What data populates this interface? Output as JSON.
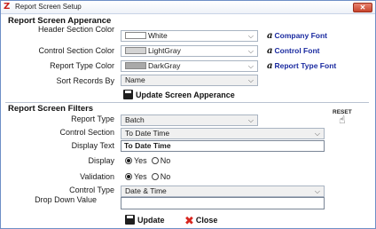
{
  "window": {
    "title": "Report Screen Setup",
    "close_glyph": "✕",
    "app_icon": "Z"
  },
  "appearance": {
    "section_title": "Report Screen Apperance",
    "header_color_label": "Header Section Color",
    "header_color_value": "White",
    "control_color_label": "Control Section Color",
    "control_color_value": "LightGray",
    "report_type_color_label": "Report Type Color",
    "report_type_color_value": "DarkGray",
    "sort_label": "Sort Records By",
    "sort_value": "Name",
    "company_font": "Company Font",
    "control_font": "Control Font",
    "report_type_font": "Report Type Font",
    "update_label": "Update Screen Apperance"
  },
  "filters": {
    "section_title": "Report Screen Filters",
    "report_type_label": "Report Type",
    "report_type_value": "Batch",
    "control_section_label": "Control Section",
    "control_section_value": "To Date Time",
    "display_text_label": "Display Text",
    "display_text_value": "To Date Time",
    "display_label": "Display",
    "display_yes": "Yes",
    "display_no": "No",
    "validation_label": "Validation",
    "validation_yes": "Yes",
    "validation_no": "No",
    "control_type_label": "Control Type",
    "control_type_value": "Date & Time",
    "dropdown_value_label": "Drop Down Value",
    "reset_label": "RESET",
    "update_label": "Update",
    "close_label": "Close"
  },
  "colors": {
    "white_swatch": "#ffffff",
    "lightgray_swatch": "#d3d3d3",
    "darkgray_swatch": "#a9a9a9",
    "link_blue": "#1a2aa0"
  },
  "icons": {
    "dropdown": "chevron-down-icon",
    "font": "font-icon",
    "save": "floppy-disk-icon",
    "close": "red-x-icon",
    "reset": "hand-pointer-icon"
  }
}
